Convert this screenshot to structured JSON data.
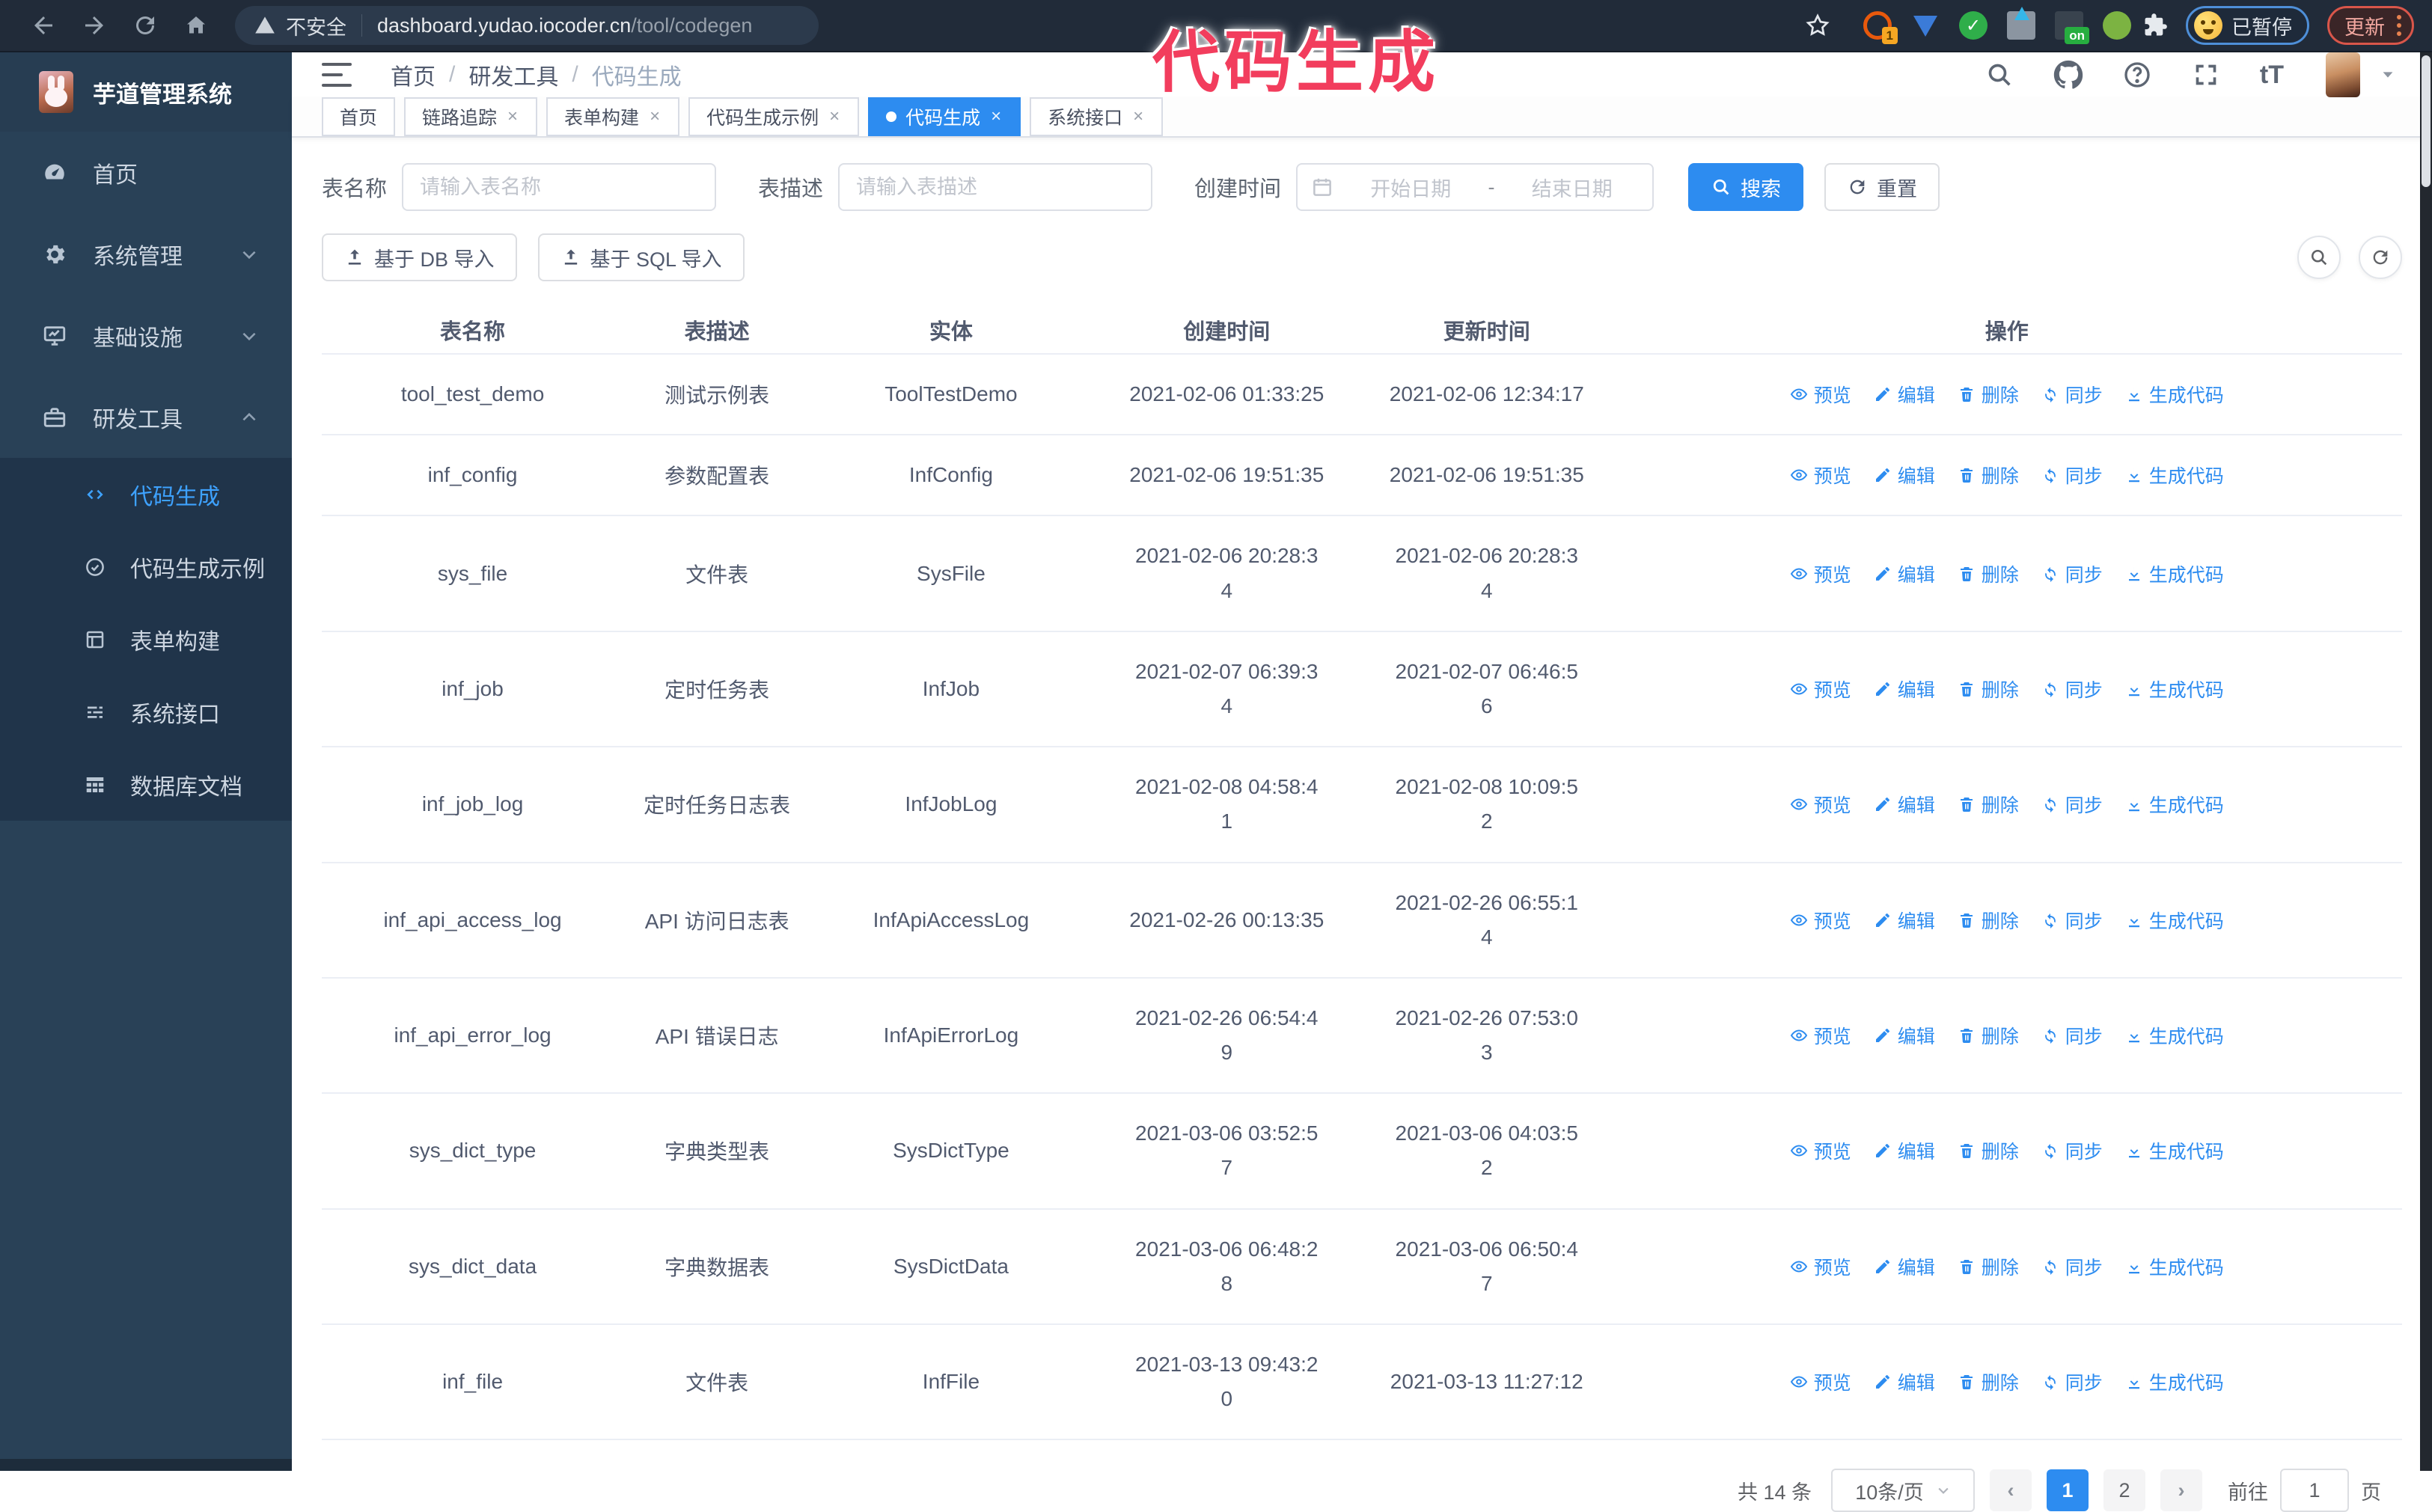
{
  "browser": {
    "security_label": "不安全",
    "url_host": "dashboard.yudao.iocoder.cn",
    "url_path": "/tool/codegen",
    "extension_badge": "1",
    "extension_on_badge": "on",
    "paused_badge": "已暂停",
    "update_button": "更新"
  },
  "overlay_title": "代码生成",
  "app": {
    "logo_title": "芋道管理系统",
    "breadcrumb": [
      "首页",
      "研发工具",
      "代码生成"
    ]
  },
  "sidebar": {
    "items": [
      {
        "label": "首页",
        "icon": "dashboard-icon"
      },
      {
        "label": "系统管理",
        "icon": "gear-icon"
      },
      {
        "label": "基础设施",
        "icon": "monitor-icon"
      },
      {
        "label": "研发工具",
        "icon": "toolbox-icon"
      }
    ],
    "submenu": [
      {
        "label": "代码生成",
        "icon": "code-icon",
        "active": true
      },
      {
        "label": "代码生成示例",
        "icon": "example-icon",
        "active": false
      },
      {
        "label": "表单构建",
        "icon": "form-icon",
        "active": false
      },
      {
        "label": "系统接口",
        "icon": "api-icon",
        "active": false
      },
      {
        "label": "数据库文档",
        "icon": "database-icon",
        "active": false
      }
    ]
  },
  "tabs": [
    {
      "label": "首页",
      "closable": false,
      "active": false
    },
    {
      "label": "链路追踪",
      "closable": true,
      "active": false
    },
    {
      "label": "表单构建",
      "closable": true,
      "active": false
    },
    {
      "label": "代码生成示例",
      "closable": true,
      "active": false
    },
    {
      "label": "代码生成",
      "closable": true,
      "active": true
    },
    {
      "label": "系统接口",
      "closable": true,
      "active": false
    }
  ],
  "filters": {
    "table_name_label": "表名称",
    "table_name_placeholder": "请输入表名称",
    "table_desc_label": "表描述",
    "table_desc_placeholder": "请输入表描述",
    "create_time_label": "创建时间",
    "date_start_placeholder": "开始日期",
    "date_separator": "-",
    "date_end_placeholder": "结束日期",
    "search_label": "搜索",
    "reset_label": "重置"
  },
  "toolbar": {
    "import_db_label": "基于 DB 导入",
    "import_sql_label": "基于 SQL 导入"
  },
  "table": {
    "columns": [
      "表名称",
      "表描述",
      "实体",
      "创建时间",
      "更新时间",
      "操作"
    ],
    "actions": [
      {
        "label": "预览",
        "icon": "eye-icon",
        "name": "preview"
      },
      {
        "label": "编辑",
        "icon": "edit-icon",
        "name": "edit"
      },
      {
        "label": "删除",
        "icon": "delete-icon",
        "name": "delete"
      },
      {
        "label": "同步",
        "icon": "sync-icon",
        "name": "sync"
      },
      {
        "label": "生成代码",
        "icon": "download-icon",
        "name": "generate-code"
      }
    ],
    "rows": [
      {
        "name": "tool_test_demo",
        "description": "测试示例表",
        "entity": "ToolTestDemo",
        "create_time": "2021-02-06 01:33:25",
        "update_time": "2021-02-06 12:34:17"
      },
      {
        "name": "inf_config",
        "description": "参数配置表",
        "entity": "InfConfig",
        "create_time": "2021-02-06 19:51:35",
        "update_time": "2021-02-06 19:51:35"
      },
      {
        "name": "sys_file",
        "description": "文件表",
        "entity": "SysFile",
        "create_time": "2021-02-06 20:28:3\n4",
        "update_time": "2021-02-06 20:28:3\n4"
      },
      {
        "name": "inf_job",
        "description": "定时任务表",
        "entity": "InfJob",
        "create_time": "2021-02-07 06:39:3\n4",
        "update_time": "2021-02-07 06:46:5\n6"
      },
      {
        "name": "inf_job_log",
        "description": "定时任务日志表",
        "entity": "InfJobLog",
        "create_time": "2021-02-08 04:58:4\n1",
        "update_time": "2021-02-08 10:09:5\n2"
      },
      {
        "name": "inf_api_access_log",
        "description": "API 访问日志表",
        "entity": "InfApiAccessLog",
        "create_time": "2021-02-26 00:13:35",
        "update_time": "2021-02-26 06:55:1\n4"
      },
      {
        "name": "inf_api_error_log",
        "description": "API 错误日志",
        "entity": "InfApiErrorLog",
        "create_time": "2021-02-26 06:54:4\n9",
        "update_time": "2021-02-26 07:53:0\n3"
      },
      {
        "name": "sys_dict_type",
        "description": "字典类型表",
        "entity": "SysDictType",
        "create_time": "2021-03-06 03:52:5\n7",
        "update_time": "2021-03-06 04:03:5\n2"
      },
      {
        "name": "sys_dict_data",
        "description": "字典数据表",
        "entity": "SysDictData",
        "create_time": "2021-03-06 06:48:2\n8",
        "update_time": "2021-03-06 06:50:4\n7"
      },
      {
        "name": "inf_file",
        "description": "文件表",
        "entity": "InfFile",
        "create_time": "2021-03-13 09:43:2\n0",
        "update_time": "2021-03-13 11:27:12"
      }
    ]
  },
  "pagination": {
    "total": "共 14 条",
    "page_size": "10条/页",
    "pages": [
      "1",
      "2"
    ],
    "active_page": "1",
    "prev_label": "‹",
    "next_label": "›",
    "goto_label": "前往",
    "goto_value": "1",
    "page_unit": "页"
  },
  "colors": {
    "accent": "#2d8cf0",
    "sidebar_bg": "#294157",
    "submenu_bg": "#20344a",
    "annotation": "#f23d5d"
  }
}
